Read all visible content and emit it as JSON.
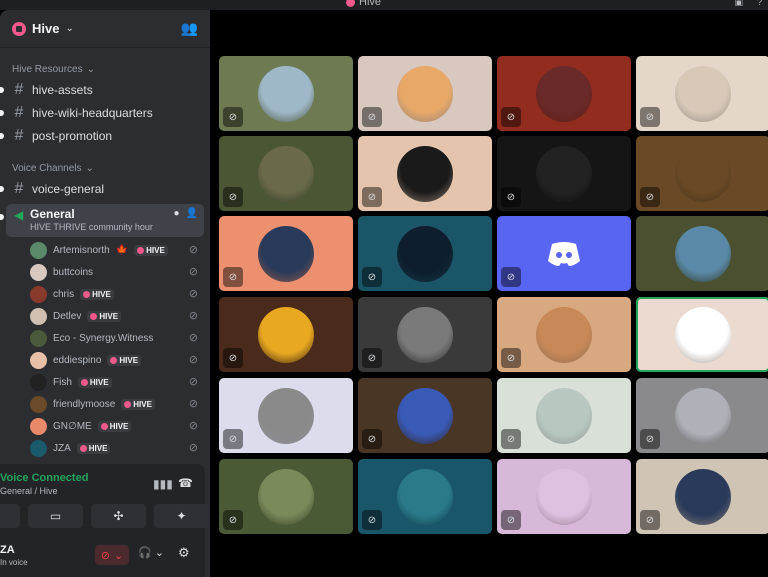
{
  "window": {
    "title": "Hive"
  },
  "server": {
    "name": "Hive"
  },
  "categories": {
    "resources": "Hive Resources",
    "voice": "Voice Channels"
  },
  "text_channels": [
    {
      "name": "hive-assets"
    },
    {
      "name": "hive-wiki-headquarters"
    },
    {
      "name": "post-promotion"
    }
  ],
  "voice_text_channel": {
    "name": "voice-general"
  },
  "active_voice": {
    "name": "General",
    "status": "HIVE THRIVE community hour"
  },
  "badge_label": "HIVE",
  "members": [
    {
      "name": "Artemisnorth",
      "maple": true,
      "badge": true,
      "color": "#5a8a6a"
    },
    {
      "name": "buttcoins",
      "badge": false,
      "color": "#d8c8c0"
    },
    {
      "name": "chris",
      "badge": true,
      "color": "#8a3a2a"
    },
    {
      "name": "Detlev",
      "badge": true,
      "color": "#d0c0b0"
    },
    {
      "name": "Eco - Synergy.Witness",
      "badge": false,
      "color": "#4a5a3a"
    },
    {
      "name": "eddiespino",
      "badge": true,
      "color": "#e8c0a8"
    },
    {
      "name": "Fish",
      "badge": true,
      "color": "#222222"
    },
    {
      "name": "friendlymoose",
      "badge": true,
      "color": "#6a4a2a"
    },
    {
      "name": "GN∅ME",
      "badge": true,
      "color": "#e88a6a"
    },
    {
      "name": "JZA",
      "badge": true,
      "color": "#1a5a6a"
    }
  ],
  "voice_connection": {
    "title": "Voice Connected",
    "subtitle": "General / Hive"
  },
  "user": {
    "name": "ZA",
    "status": "In voice"
  },
  "tiles": [
    {
      "bg": "#6e7a52",
      "avatar": "#9fb8c8"
    },
    {
      "bg": "#d8c8c0",
      "avatar": "#e8a868"
    },
    {
      "bg": "#922c1e",
      "avatar": "#6a2a2a"
    },
    {
      "bg": "#e4d6c8",
      "avatar": "#d8c8b8"
    },
    {
      "bg": "#4a5634",
      "avatar": "#6a6a4a"
    },
    {
      "bg": "#e4c4ac",
      "avatar": "#1a1a1a"
    },
    {
      "bg": "#151515",
      "avatar": "#222222"
    },
    {
      "bg": "#6a4a26",
      "avatar": "#6a4a26"
    },
    {
      "bg": "#ec9070",
      "avatar": "#2a3a5a"
    },
    {
      "bg": "#1a5668",
      "avatar": "#0e1e2e"
    },
    {
      "bg": "#5865f2",
      "avatar": "#5865f2",
      "discord": true
    },
    {
      "bg": "#4a5030",
      "avatar": "#5a8aa8"
    },
    {
      "bg": "#4a2a1a",
      "avatar": "#e8a820"
    },
    {
      "bg": "#3a3a3a",
      "avatar": "#7a7a7a"
    },
    {
      "bg": "#d8a880",
      "avatar": "#c88858"
    },
    {
      "bg": "#eadad0",
      "avatar": "#ffffff",
      "speaking": true
    },
    {
      "bg": "#dcdcec",
      "avatar": "#8a8a8a"
    },
    {
      "bg": "#4a3624",
      "avatar": "#3a5ab8"
    },
    {
      "bg": "#d8e0d8",
      "avatar": "#b8c8c0"
    },
    {
      "bg": "#8a8a8c",
      "avatar": "#b0b0b8"
    },
    {
      "bg": "#4a5a34",
      "avatar": "#7a8a5a"
    },
    {
      "bg": "#1a566a",
      "avatar": "#2a7a8a"
    },
    {
      "bg": "#d8b8d8",
      "avatar": "#e0c0e0"
    },
    {
      "bg": "#d0c4b4",
      "avatar": "#2a3a5a"
    }
  ]
}
